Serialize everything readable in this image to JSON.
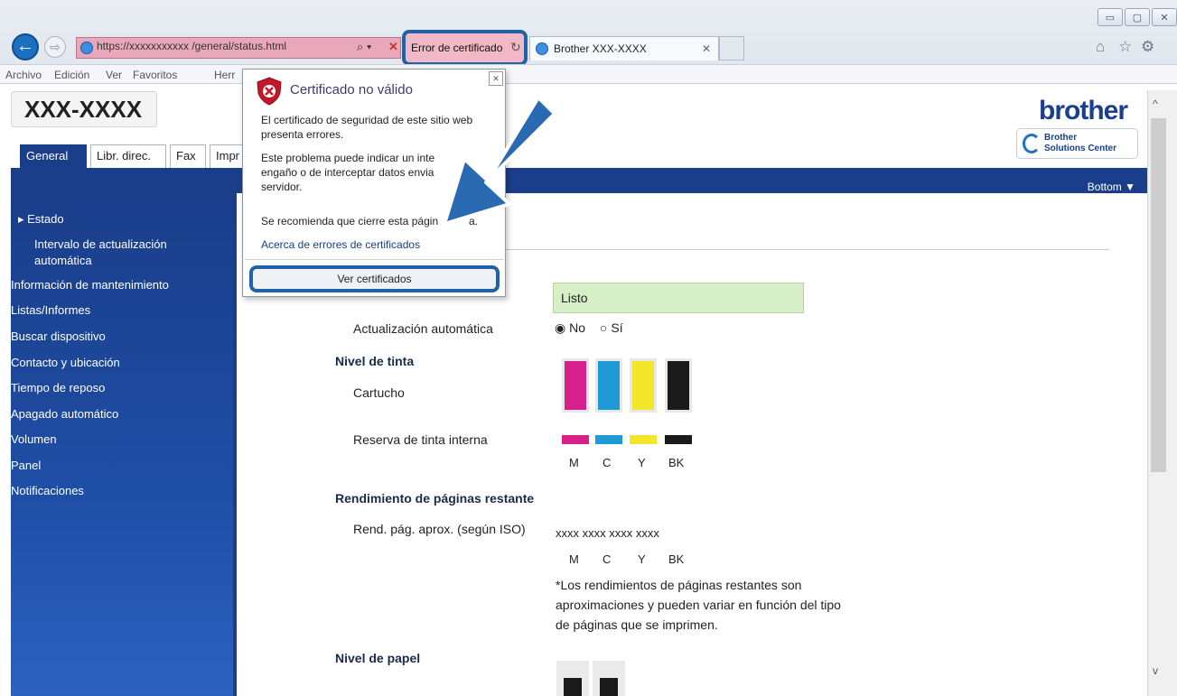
{
  "window_controls": {
    "minimize": "▭",
    "maximize": "▢",
    "close": "✕"
  },
  "address_bar": {
    "url": "https://xxxxxxxxxxx /general/status.html",
    "search_symbol": "⌕ ▾",
    "error_symbol": "✕"
  },
  "cert_error_tab": {
    "label": "Error de certificado",
    "refresh_symbol": "↻"
  },
  "tab": {
    "title": "Brother XXX-XXXX",
    "close_symbol": "✕"
  },
  "toolbar_icons": {
    "home": "⌂",
    "favorites": "☆",
    "settings": "⚙"
  },
  "menu": {
    "items": [
      "Archivo",
      "Edición",
      "Ver",
      "Favoritos",
      "Herr"
    ]
  },
  "header": {
    "model": "XXX-XXXX",
    "brand": "brother",
    "solutions_center": {
      "line1": "Brother",
      "line2": "Solutions Center"
    }
  },
  "tabs": [
    "General",
    "Libr. direc.",
    "Fax",
    "Impr"
  ],
  "bottom_link": "Bottom ▼",
  "sidebar": {
    "items": [
      "Estado",
      "Intervalo de actualización",
      "automática",
      "Información de mantenimiento",
      "Listas/Informes",
      "Buscar dispositivo",
      "Contacto y ubicación",
      "Tiempo de reposo",
      "Apagado automático",
      "Volumen",
      "Panel",
      "Notificaciones"
    ]
  },
  "status": {
    "value": "Listo",
    "auto_update_label": "Actualización automática",
    "auto_update_no": "No",
    "auto_update_si": "Sí",
    "ink_section": "Nivel de tinta",
    "cartridge_label": "Cartucho",
    "reserve_label": "Reserva de tinta interna",
    "ink_letters": [
      "M",
      "C",
      "Y",
      "BK"
    ],
    "ink_colors": [
      "#d6218c",
      "#1e9ad6",
      "#f2e52c",
      "#1a1a1a"
    ],
    "yield_section": "Rendimiento de páginas restante",
    "yield_label": "Rend. pág. aprox. (según ISO)",
    "yield_values": "xxxx xxxx xxxx xxxx",
    "yield_letters": [
      "M",
      "C",
      "Y",
      "BK"
    ],
    "yield_note_1": "*Los rendimientos de páginas restantes son",
    "yield_note_2": "aproximaciones y pueden variar en función del tipo",
    "yield_note_3": "de páginas que se imprimen.",
    "paper_section": "Nivel de papel"
  },
  "popup": {
    "title": "Certificado no válido",
    "close": "✕",
    "p1_line1": "El certificado de seguridad de este sitio web",
    "p1_line2": "presenta errores.",
    "p2_line1": "Este problema puede indicar un inte",
    "p2_line2": "engaño o de interceptar datos envia",
    "p2_line3": "servidor.",
    "recommend": "Se recomienda que cierre esta págin",
    "recommend_tail": "a.",
    "link": "Acerca de errores de certificados",
    "button": "Ver certificados"
  }
}
